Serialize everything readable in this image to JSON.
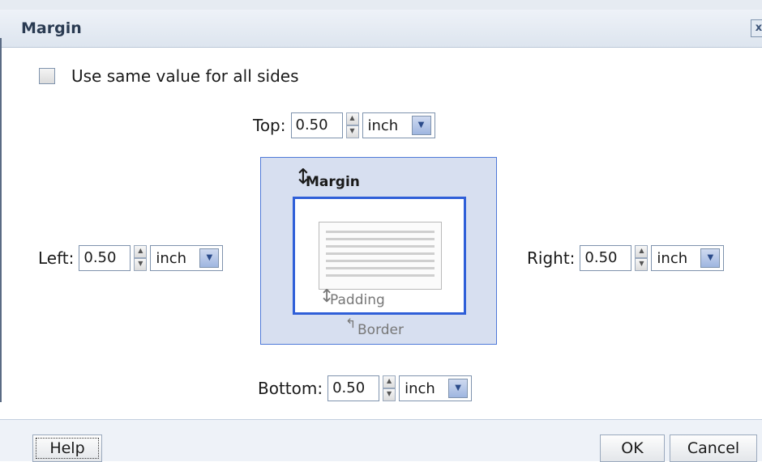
{
  "dialog": {
    "title": "Margin",
    "close_glyph": "x"
  },
  "same_value": {
    "label": "Use same value for all sides",
    "checked": false
  },
  "top": {
    "label": "Top:",
    "value": "0.50",
    "unit": "inch"
  },
  "left": {
    "label": "Left:",
    "value": "0.50",
    "unit": "inch"
  },
  "right": {
    "label": "Right:",
    "value": "0.50",
    "unit": "inch"
  },
  "bottom": {
    "label": "Bottom:",
    "value": "0.50",
    "unit": "inch"
  },
  "diagram": {
    "margin_label": "Margin",
    "padding_label": "Padding",
    "border_label": "Border"
  },
  "buttons": {
    "help": "Help",
    "ok": "OK",
    "cancel": "Cancel"
  },
  "icons": {
    "spinner": "spinner-arrows-icon",
    "dropdown": "chevron-down-icon",
    "arrow": "double-arrow-icon"
  },
  "colors": {
    "accent": "#2f5fd8",
    "diagram_fill": "#d7dff0",
    "title_text": "#2a3b52"
  }
}
